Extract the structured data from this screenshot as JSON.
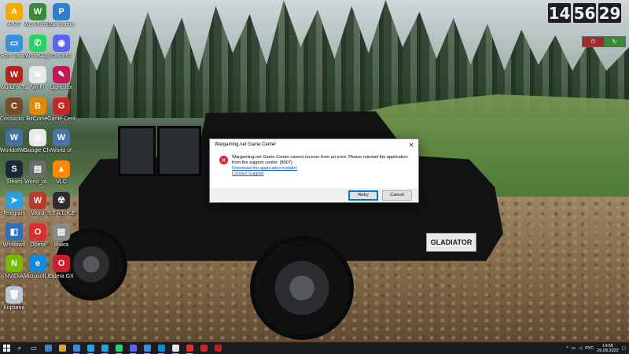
{
  "desktop": {
    "icons": [
      {
        "label": "AIMP",
        "color": "#f2a900",
        "glyph": "A"
      },
      {
        "label": "WG Интеллект",
        "color": "#3a8a3a",
        "glyph": "W"
      },
      {
        "label": "Panorama",
        "color": "#2f7fd1",
        "glyph": "P"
      },
      {
        "label": "Этот компьютер",
        "color": "#3b8fd9",
        "glyph": "▭"
      },
      {
        "label": "WhatsApp",
        "color": "#25d366",
        "glyph": "✆"
      },
      {
        "label": "Discord",
        "color": "#5865f2",
        "glyph": "◉"
      },
      {
        "label": "World of Tanks",
        "color": "#b3261e",
        "glyph": "W"
      },
      {
        "label": "Wi-Fi",
        "color": "#e8e8e8",
        "glyph": "≋"
      },
      {
        "label": "Lightshot",
        "color": "#c2185b",
        "glyph": "✎"
      },
      {
        "label": "Cossacks 3",
        "color": "#7a4b2a",
        "glyph": "C"
      },
      {
        "label": "BitComet",
        "color": "#e08a00",
        "glyph": "B"
      },
      {
        "label": "Game Center",
        "color": "#c62828",
        "glyph": "G"
      },
      {
        "label": "WorldofWars",
        "color": "#456f9e",
        "glyph": "W"
      },
      {
        "label": "Google Chrome",
        "color": "#e8e8e8",
        "glyph": "◎"
      },
      {
        "label": "World of",
        "color": "#4a74a8",
        "glyph": "W"
      },
      {
        "label": "Steam",
        "color": "#1b2838",
        "glyph": "S"
      },
      {
        "label": "World_of...",
        "color": "#6b6b6b",
        "glyph": "▤"
      },
      {
        "label": "VLC",
        "color": "#ff8800",
        "glyph": "▲"
      },
      {
        "label": "Telegram",
        "color": "#2aa1da",
        "glyph": "➤"
      },
      {
        "label": "Word",
        "color": "#b83b2b",
        "glyph": "W"
      },
      {
        "label": "S.T.A.L.K.E.R. OGSR Mod",
        "color": "#2d2d2d",
        "glyph": "☢"
      },
      {
        "label": "Windows",
        "color": "#2f6fbf",
        "glyph": "◧"
      },
      {
        "label": "Opera",
        "color": "#d92f2f",
        "glyph": "O"
      },
      {
        "label": "Книга",
        "color": "#8a8a8a",
        "glyph": "▤"
      },
      {
        "label": "NVIDIA",
        "color": "#76b900",
        "glyph": "N"
      },
      {
        "label": "Microsoft Edge",
        "color": "#0f8bd6",
        "glyph": "e"
      },
      {
        "label": "Opera GX",
        "color": "#cc1f2d",
        "glyph": "O"
      },
      {
        "label": "Корзина",
        "color": "#b8c6d6",
        "glyph": "🗑"
      }
    ]
  },
  "clock_widget": {
    "hours": "14",
    "minutes": "56",
    "seconds": "29",
    "power_on": "⏻",
    "power_restart": "↻"
  },
  "wallpaper": {
    "plate_text": "GLADIATOR"
  },
  "dialog": {
    "title": "Wargaming.net Game Center",
    "close_glyph": "✕",
    "icon_glyph": "✕",
    "message": "Wargaming.net Game Center cannot recover from an error. Please reinstall the application from the support center. (8007)",
    "link_download": "Download the application installer",
    "link_support": "Contact Support",
    "retry_label": "Retry",
    "cancel_label": "Cancel"
  },
  "taskbar": {
    "apps": [
      {
        "name": "search",
        "glyph": "⌕",
        "color": "#ffffff"
      },
      {
        "name": "task-view",
        "glyph": "▭",
        "color": "#ffffff"
      },
      {
        "name": "app-1",
        "glyph": "",
        "color": "#4a7cc9"
      },
      {
        "name": "app-2",
        "glyph": "",
        "color": "#d8a23a"
      },
      {
        "name": "app-3",
        "glyph": "",
        "color": "#3a8ad8"
      },
      {
        "name": "app-4",
        "glyph": "",
        "color": "#2aa1da"
      },
      {
        "name": "app-5",
        "glyph": "",
        "color": "#2aa1da"
      },
      {
        "name": "app-6",
        "glyph": "",
        "color": "#25d366"
      },
      {
        "name": "app-7",
        "glyph": "",
        "color": "#5865f2"
      },
      {
        "name": "app-8",
        "glyph": "",
        "color": "#3b8fd9"
      },
      {
        "name": "app-9",
        "glyph": "",
        "color": "#0f8bd6"
      },
      {
        "name": "app-10",
        "glyph": "",
        "color": "#e8e8e8"
      },
      {
        "name": "app-11",
        "glyph": "",
        "color": "#d92f2f"
      },
      {
        "name": "app-12",
        "glyph": "",
        "color": "#c62828"
      },
      {
        "name": "app-13",
        "glyph": "",
        "color": "#b3261e"
      }
    ],
    "tray": {
      "chevron": "^",
      "language": "РУС",
      "time": "14:56",
      "date": "26.09.2022"
    }
  }
}
